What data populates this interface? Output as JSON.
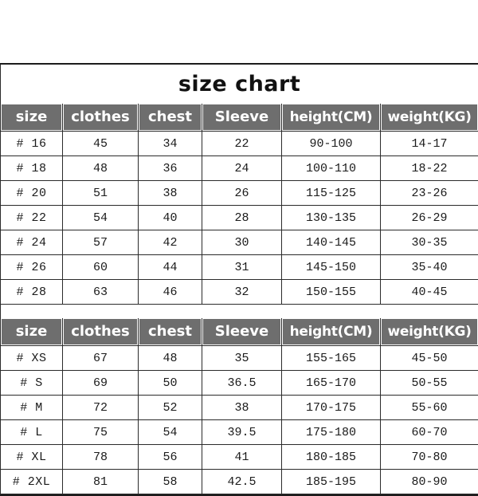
{
  "document": {
    "title": "size chart"
  },
  "columns": [
    "size",
    "clothes",
    "chest",
    "Sleeve",
    "height(CM)",
    "weight(KG)"
  ],
  "tables": [
    {
      "id": "youth-size-table",
      "headers": [
        "size",
        "clothes",
        "chest",
        "Sleeve",
        "height(CM)",
        "weight(KG)"
      ],
      "rows": [
        [
          "# 16",
          "45",
          "34",
          "22",
          "90-100",
          "14-17"
        ],
        [
          "# 18",
          "48",
          "36",
          "24",
          "100-110",
          "18-22"
        ],
        [
          "# 20",
          "51",
          "38",
          "26",
          "115-125",
          "23-26"
        ],
        [
          "# 22",
          "54",
          "40",
          "28",
          "130-135",
          "26-29"
        ],
        [
          "# 24",
          "57",
          "42",
          "30",
          "140-145",
          "30-35"
        ],
        [
          "# 26",
          "60",
          "44",
          "31",
          "145-150",
          "35-40"
        ],
        [
          "# 28",
          "63",
          "46",
          "32",
          "150-155",
          "40-45"
        ]
      ]
    },
    {
      "id": "adult-size-table",
      "headers": [
        "size",
        "clothes",
        "chest",
        "Sleeve",
        "height(CM)",
        "weight(KG)"
      ],
      "rows": [
        [
          "# XS",
          "67",
          "48",
          "35",
          "155-165",
          "45-50"
        ],
        [
          "# S",
          "69",
          "50",
          "36.5",
          "165-170",
          "50-55"
        ],
        [
          "# M",
          "72",
          "52",
          "38",
          "170-175",
          "55-60"
        ],
        [
          "# L",
          "75",
          "54",
          "39.5",
          "175-180",
          "60-70"
        ],
        [
          "# XL",
          "78",
          "56",
          "41",
          "180-185",
          "70-80"
        ],
        [
          "# 2XL",
          "81",
          "58",
          "42.5",
          "185-195",
          "80-90"
        ]
      ]
    }
  ],
  "colors": {
    "header_band": "#6e6e6e",
    "header_text": "#ffffff",
    "border": "#2b2b2b",
    "page_background": "#ffffff",
    "body_text": "#1a1a1a"
  }
}
